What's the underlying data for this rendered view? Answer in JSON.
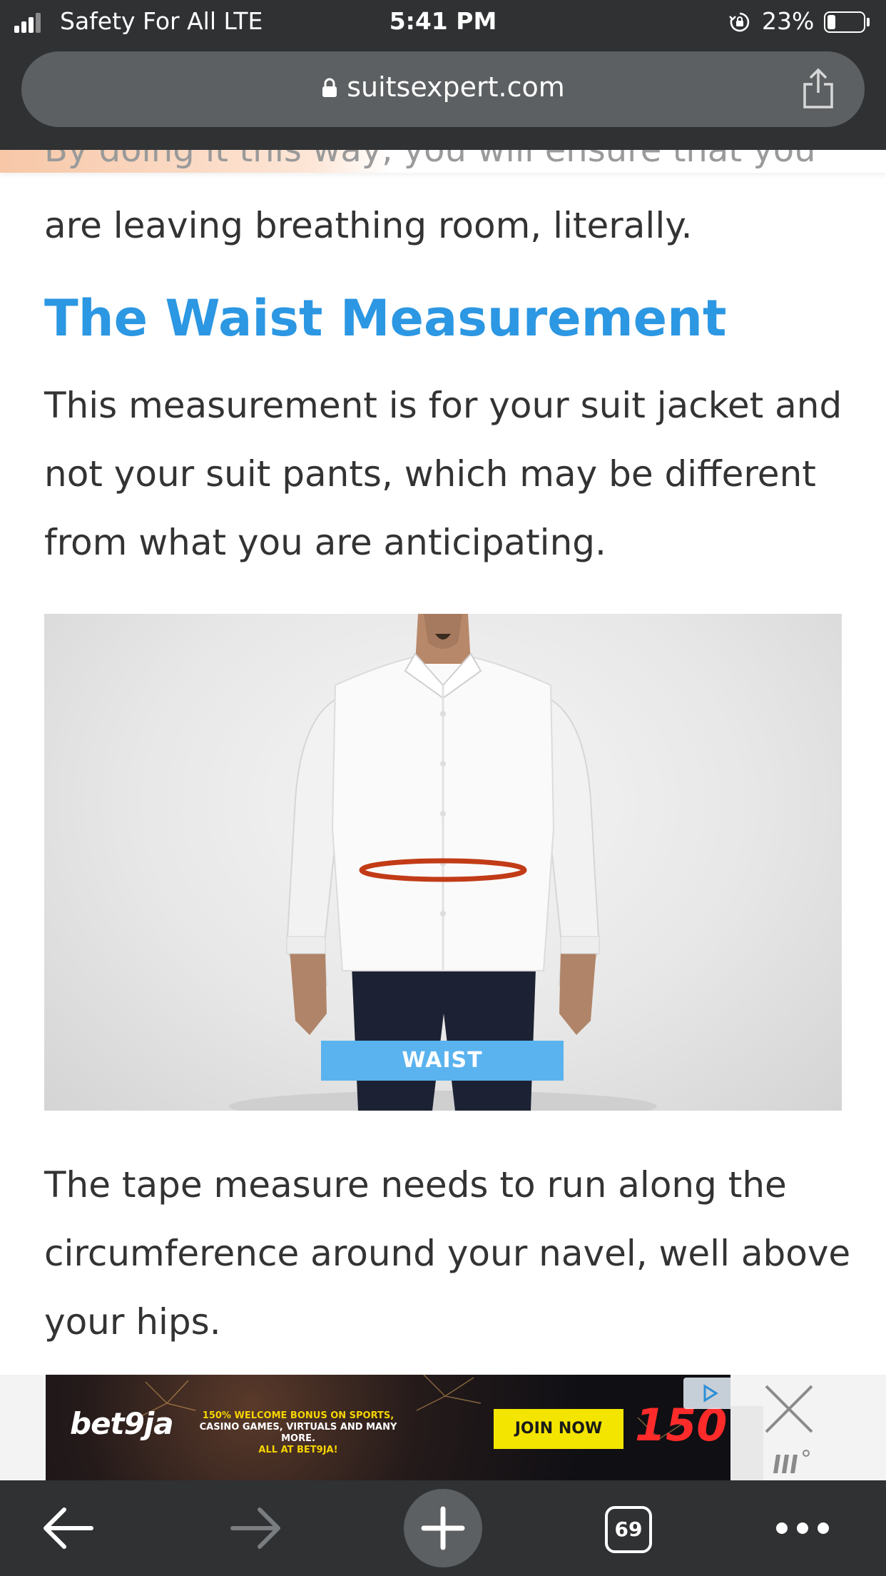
{
  "status_bar": {
    "carrier": "Safety For All  LTE",
    "time": "5:41 PM",
    "battery_percent": "23%",
    "battery_level": 0.23,
    "signal_bars": 3
  },
  "browser": {
    "url": "suitsexpert.com",
    "tab_count": "69",
    "icons": {
      "lock": "lock-icon",
      "share": "share-icon",
      "back": "back-arrow-icon",
      "forward": "forward-arrow-icon",
      "new_tab": "plus-icon",
      "menu": "more-dots-icon"
    }
  },
  "article": {
    "faded_line": "By doing it this way, you will ensure that you",
    "intro_line": "are leaving breathing room, literally.",
    "heading": "The Waist Measurement",
    "paragraph1": "This measurement is for your suit jacket and not your suit pants, which may be different from what you are anticipating.",
    "figure_label": "WAIST",
    "paragraph2": "The tape measure needs to run along the circumference around your navel, well above your hips."
  },
  "ad": {
    "logo": "bet9ja",
    "line1": "150% WELCOME BONUS ON SPORTS,",
    "line2": "CASINO GAMES, VIRTUALS AND MANY MORE.",
    "line3": "ALL AT BET9JA!",
    "cta": "JOIN NOW",
    "headline": "150!"
  },
  "colors": {
    "heading": "#2c97e2",
    "chrome": "#2f3133",
    "url_pill": "#5c6062",
    "waist_label": "#5ab3ef",
    "tape": "#c23b17"
  }
}
